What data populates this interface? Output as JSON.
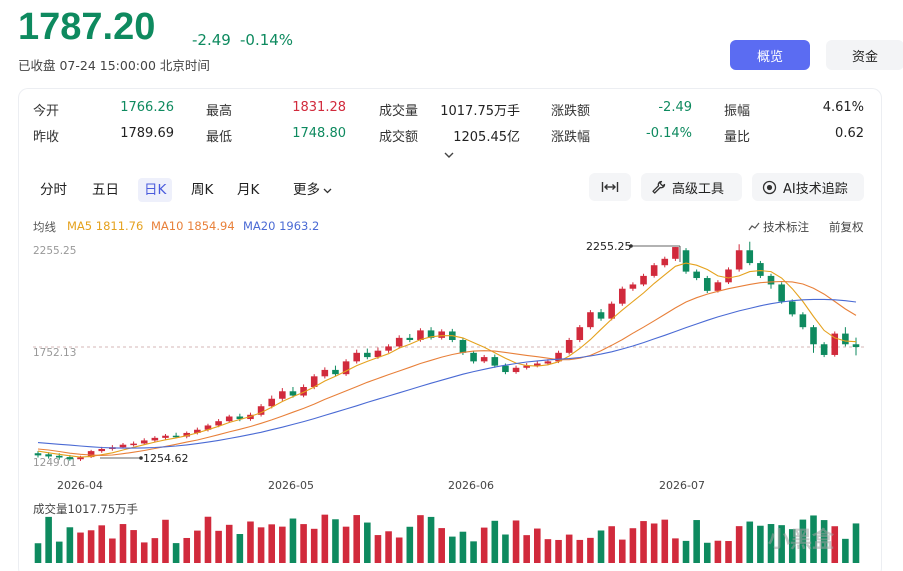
{
  "header": {
    "price": "1787.20",
    "change": "-2.49",
    "change_pct": "-0.14%",
    "status": "已收盘  07-24 15:00:00 北京时间",
    "btn_overview": "概览",
    "btn_funds": "资金"
  },
  "stats": {
    "open_label": "今开",
    "open": "1766.26",
    "high_label": "最高",
    "high": "1831.28",
    "volume_label": "成交量",
    "volume": "1017.75万手",
    "chg_amt_label": "涨跌额",
    "chg_amt": "-2.49",
    "amplitude_label": "振幅",
    "amplitude": "4.61%",
    "prev_label": "昨收",
    "prev": "1789.69",
    "low_label": "最低",
    "low": "1748.80",
    "turnover_label": "成交额",
    "turnover": "1205.45亿",
    "chg_pct_label": "涨跌幅",
    "chg_pct": "-0.14%",
    "vol_ratio_label": "量比",
    "vol_ratio": "0.62"
  },
  "tabs": {
    "intraday": "分时",
    "five_day": "五日",
    "daily": "日K",
    "weekly": "周K",
    "monthly": "月K",
    "more": "更多"
  },
  "tools": {
    "advanced": "高级工具",
    "ai": "AI技术追踪"
  },
  "ma": {
    "label": "均线",
    "ma5": "MA5 1811.76",
    "ma10": "MA10 1854.94",
    "ma20": "MA20 1963.2"
  },
  "links": {
    "tech": "技术标注",
    "adjust": "前复权"
  },
  "volume_label": "成交量1017.75万手",
  "watermark": "小黑盒",
  "colors": {
    "up": "#d12a3c",
    "down": "#0e8a5f",
    "accent": "#5b6cf2"
  },
  "chart_data": {
    "type": "candlestick",
    "ylabels": [
      "2255.25",
      "1752.13",
      "1249.01"
    ],
    "xlabels": [
      "2026-04",
      "2026-05",
      "2026-06",
      "2026-07"
    ],
    "annotations": {
      "high": "2255.25",
      "low": "1254.62"
    },
    "ohlc": [
      [
        1290,
        1280,
        1300,
        1270
      ],
      [
        1285,
        1275,
        1295,
        1265
      ],
      [
        1278,
        1270,
        1290,
        1260
      ],
      [
        1272,
        1262,
        1282,
        1255
      ],
      [
        1262,
        1270,
        1278,
        1254
      ],
      [
        1272,
        1300,
        1306,
        1268
      ],
      [
        1300,
        1310,
        1320,
        1292
      ],
      [
        1310,
        1318,
        1328,
        1302
      ],
      [
        1318,
        1330,
        1338,
        1312
      ],
      [
        1330,
        1335,
        1345,
        1322
      ],
      [
        1336,
        1350,
        1360,
        1330
      ],
      [
        1350,
        1362,
        1370,
        1342
      ],
      [
        1362,
        1372,
        1380,
        1352
      ],
      [
        1372,
        1368,
        1386,
        1360
      ],
      [
        1368,
        1385,
        1392,
        1360
      ],
      [
        1385,
        1400,
        1410,
        1378
      ],
      [
        1400,
        1420,
        1428,
        1392
      ],
      [
        1420,
        1440,
        1450,
        1412
      ],
      [
        1440,
        1462,
        1470,
        1432
      ],
      [
        1462,
        1450,
        1475,
        1440
      ],
      [
        1450,
        1470,
        1480,
        1442
      ],
      [
        1470,
        1510,
        1520,
        1462
      ],
      [
        1510,
        1545,
        1560,
        1500
      ],
      [
        1545,
        1580,
        1595,
        1535
      ],
      [
        1580,
        1560,
        1600,
        1550
      ],
      [
        1560,
        1600,
        1612,
        1552
      ],
      [
        1600,
        1650,
        1660,
        1590
      ],
      [
        1650,
        1680,
        1692,
        1640
      ],
      [
        1680,
        1660,
        1700,
        1650
      ],
      [
        1660,
        1720,
        1730,
        1652
      ],
      [
        1720,
        1760,
        1775,
        1710
      ],
      [
        1760,
        1740,
        1780,
        1730
      ],
      [
        1740,
        1770,
        1785,
        1732
      ],
      [
        1770,
        1790,
        1800,
        1760
      ],
      [
        1790,
        1830,
        1842,
        1780
      ],
      [
        1830,
        1820,
        1848,
        1810
      ],
      [
        1820,
        1865,
        1875,
        1812
      ],
      [
        1865,
        1830,
        1880,
        1822
      ],
      [
        1830,
        1860,
        1870,
        1822
      ],
      [
        1860,
        1820,
        1872,
        1810
      ],
      [
        1820,
        1760,
        1830,
        1750
      ],
      [
        1760,
        1720,
        1770,
        1710
      ],
      [
        1720,
        1740,
        1750,
        1712
      ],
      [
        1740,
        1700,
        1752,
        1690
      ],
      [
        1700,
        1670,
        1710,
        1660
      ],
      [
        1670,
        1690,
        1700,
        1662
      ],
      [
        1690,
        1700,
        1712,
        1682
      ],
      [
        1700,
        1710,
        1720,
        1692
      ],
      [
        1710,
        1720,
        1730,
        1702
      ],
      [
        1720,
        1760,
        1770,
        1712
      ],
      [
        1760,
        1820,
        1830,
        1752
      ],
      [
        1820,
        1880,
        1890,
        1810
      ],
      [
        1880,
        1950,
        1960,
        1870
      ],
      [
        1950,
        1920,
        1965,
        1910
      ],
      [
        1920,
        1990,
        2000,
        1912
      ],
      [
        1990,
        2060,
        2070,
        1980
      ],
      [
        2060,
        2080,
        2090,
        2050
      ],
      [
        2080,
        2120,
        2130,
        2072
      ],
      [
        2120,
        2170,
        2180,
        2112
      ],
      [
        2170,
        2200,
        2210,
        2160
      ],
      [
        2200,
        2255,
        2255,
        2190
      ],
      [
        2240,
        2140,
        2250,
        2130
      ],
      [
        2140,
        2110,
        2150,
        2100
      ],
      [
        2110,
        2050,
        2120,
        2040
      ],
      [
        2050,
        2090,
        2100,
        2042
      ],
      [
        2090,
        2150,
        2160,
        2082
      ],
      [
        2150,
        2240,
        2268,
        2140
      ],
      [
        2240,
        2180,
        2280,
        2170
      ],
      [
        2180,
        2120,
        2190,
        2110
      ],
      [
        2120,
        2080,
        2130,
        2060
      ],
      [
        2080,
        2000,
        2090,
        1990
      ],
      [
        2000,
        1940,
        2010,
        1930
      ],
      [
        1940,
        1880,
        1950,
        1870
      ],
      [
        1880,
        1800,
        1890,
        1760
      ],
      [
        1800,
        1750,
        1810,
        1740
      ],
      [
        1750,
        1850,
        1860,
        1742
      ],
      [
        1850,
        1800,
        1880,
        1790
      ],
      [
        1800,
        1787,
        1831,
        1748
      ]
    ],
    "ma5": [
      1300,
      1292,
      1285,
      1278,
      1272,
      1275,
      1283,
      1292,
      1305,
      1318,
      1330,
      1342,
      1353,
      1362,
      1372,
      1385,
      1400,
      1416,
      1434,
      1448,
      1462,
      1480,
      1505,
      1532,
      1555,
      1575,
      1600,
      1628,
      1650,
      1675,
      1700,
      1720,
      1738,
      1756,
      1782,
      1800,
      1822,
      1835,
      1840,
      1840,
      1830,
      1808,
      1786,
      1760,
      1735,
      1712,
      1700,
      1698,
      1704,
      1718,
      1745,
      1780,
      1822,
      1870,
      1918,
      1960,
      2000,
      2040,
      2085,
      2125,
      2165,
      2180,
      2170,
      2150,
      2120,
      2110,
      2120,
      2140,
      2145,
      2140,
      2110,
      2060,
      2000,
      1930,
      1865,
      1830,
      1815,
      1812
    ],
    "ma10": [
      1310,
      1305,
      1298,
      1290,
      1285,
      1282,
      1280,
      1282,
      1288,
      1295,
      1303,
      1312,
      1322,
      1332,
      1342,
      1352,
      1364,
      1377,
      1390,
      1402,
      1415,
      1430,
      1446,
      1464,
      1482,
      1500,
      1520,
      1542,
      1562,
      1582,
      1602,
      1622,
      1640,
      1658,
      1675,
      1692,
      1710,
      1725,
      1740,
      1752,
      1762,
      1768,
      1770,
      1768,
      1762,
      1755,
      1748,
      1742,
      1735,
      1728,
      1728,
      1735,
      1748,
      1770,
      1795,
      1822,
      1852,
      1880,
      1910,
      1940,
      1970,
      1998,
      2018,
      2035,
      2048,
      2060,
      2070,
      2080,
      2088,
      2092,
      2094,
      2092,
      2082,
      2062,
      2035,
      2000,
      1965,
      1935
    ],
    "ma20": [
      1340,
      1336,
      1332,
      1328,
      1324,
      1320,
      1317,
      1315,
      1314,
      1314,
      1315,
      1317,
      1320,
      1324,
      1329,
      1335,
      1342,
      1350,
      1359,
      1368,
      1378,
      1388,
      1400,
      1412,
      1425,
      1438,
      1452,
      1467,
      1482,
      1497,
      1512,
      1528,
      1543,
      1558,
      1573,
      1588,
      1603,
      1618,
      1632,
      1646,
      1660,
      1672,
      1683,
      1693,
      1702,
      1710,
      1717,
      1722,
      1727,
      1730,
      1733,
      1738,
      1745,
      1754,
      1765,
      1778,
      1792,
      1808,
      1825,
      1842,
      1860,
      1878,
      1895,
      1912,
      1928,
      1942,
      1956,
      1968,
      1980,
      1990,
      1998,
      2004,
      2008,
      2010,
      2010,
      2008,
      2004,
      1998
    ]
  }
}
